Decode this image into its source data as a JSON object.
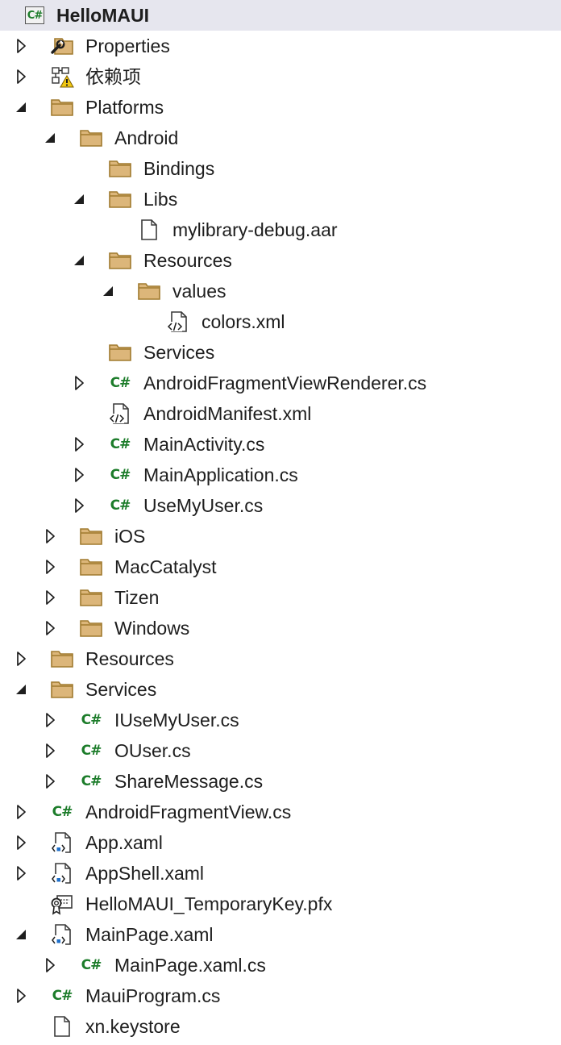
{
  "solution_explorer": {
    "items": [
      {
        "label": "HelloMAUI",
        "level": 0,
        "expander": "none",
        "icon": "csharp-project-icon",
        "selected": true
      },
      {
        "label": "Properties",
        "level": 1,
        "expander": "collapsed",
        "icon": "properties-folder-icon"
      },
      {
        "label": "依赖项",
        "level": 1,
        "expander": "collapsed",
        "icon": "dependencies-warning-icon"
      },
      {
        "label": "Platforms",
        "level": 1,
        "expander": "expanded",
        "icon": "folder-icon"
      },
      {
        "label": "Android",
        "level": 2,
        "expander": "expanded",
        "icon": "folder-icon"
      },
      {
        "label": "Bindings",
        "level": 3,
        "expander": "none",
        "icon": "folder-icon"
      },
      {
        "label": "Libs",
        "level": 3,
        "expander": "expanded",
        "icon": "folder-icon"
      },
      {
        "label": "mylibrary-debug.aar",
        "level": 4,
        "expander": "none",
        "icon": "file-icon"
      },
      {
        "label": "Resources",
        "level": 3,
        "expander": "expanded",
        "icon": "folder-icon"
      },
      {
        "label": "values",
        "level": 4,
        "expander": "expanded",
        "icon": "folder-icon"
      },
      {
        "label": "colors.xml",
        "level": 5,
        "expander": "none",
        "icon": "xml-file-icon"
      },
      {
        "label": "Services",
        "level": 3,
        "expander": "none",
        "icon": "folder-icon"
      },
      {
        "label": "AndroidFragmentViewRenderer.cs",
        "level": 3,
        "expander": "collapsed",
        "icon": "csharp-file-icon"
      },
      {
        "label": "AndroidManifest.xml",
        "level": 3,
        "expander": "none",
        "icon": "xml-file-icon"
      },
      {
        "label": "MainActivity.cs",
        "level": 3,
        "expander": "collapsed",
        "icon": "csharp-file-icon"
      },
      {
        "label": "MainApplication.cs",
        "level": 3,
        "expander": "collapsed",
        "icon": "csharp-file-icon"
      },
      {
        "label": "UseMyUser.cs",
        "level": 3,
        "expander": "collapsed",
        "icon": "csharp-file-icon"
      },
      {
        "label": "iOS",
        "level": 2,
        "expander": "collapsed",
        "icon": "folder-icon"
      },
      {
        "label": "MacCatalyst",
        "level": 2,
        "expander": "collapsed",
        "icon": "folder-icon"
      },
      {
        "label": "Tizen",
        "level": 2,
        "expander": "collapsed",
        "icon": "folder-icon"
      },
      {
        "label": "Windows",
        "level": 2,
        "expander": "collapsed",
        "icon": "folder-icon"
      },
      {
        "label": "Resources",
        "level": 1,
        "expander": "collapsed",
        "icon": "folder-icon"
      },
      {
        "label": "Services",
        "level": 1,
        "expander": "expanded",
        "icon": "folder-icon"
      },
      {
        "label": "IUseMyUser.cs",
        "level": 2,
        "expander": "collapsed",
        "icon": "csharp-file-icon"
      },
      {
        "label": "OUser.cs",
        "level": 2,
        "expander": "collapsed",
        "icon": "csharp-file-icon"
      },
      {
        "label": "ShareMessage.cs",
        "level": 2,
        "expander": "collapsed",
        "icon": "csharp-file-icon"
      },
      {
        "label": "AndroidFragmentView.cs",
        "level": 1,
        "expander": "collapsed",
        "icon": "csharp-file-icon"
      },
      {
        "label": "App.xaml",
        "level": 1,
        "expander": "collapsed",
        "icon": "xaml-file-icon"
      },
      {
        "label": "AppShell.xaml",
        "level": 1,
        "expander": "collapsed",
        "icon": "xaml-file-icon"
      },
      {
        "label": "HelloMAUI_TemporaryKey.pfx",
        "level": 1,
        "expander": "none",
        "icon": "certificate-icon"
      },
      {
        "label": "MainPage.xaml",
        "level": 1,
        "expander": "expanded",
        "icon": "xaml-file-icon"
      },
      {
        "label": "MainPage.xaml.cs",
        "level": 2,
        "expander": "collapsed",
        "icon": "csharp-file-icon"
      },
      {
        "label": "MauiProgram.cs",
        "level": 1,
        "expander": "collapsed",
        "icon": "csharp-file-icon"
      },
      {
        "label": "xn.keystore",
        "level": 1,
        "expander": "none",
        "icon": "file-icon"
      }
    ]
  },
  "colors": {
    "folder_fill": "#dcb67a",
    "folder_stroke": "#a07a2e",
    "csharp_green": "#1c7c2a",
    "selection_bg": "#e6e6ee",
    "warning_yellow": "#f2c811",
    "xaml_blue": "#1e6fc9"
  }
}
